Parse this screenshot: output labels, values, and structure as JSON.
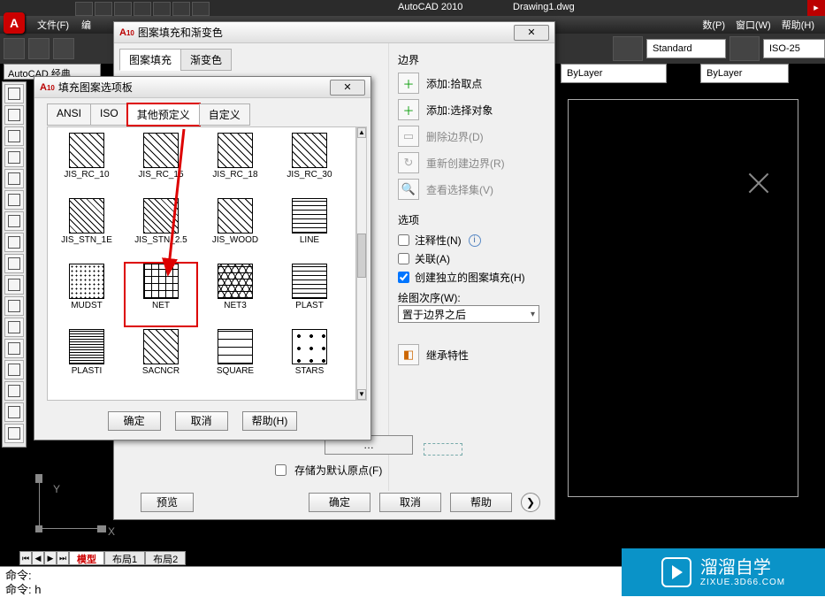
{
  "app": {
    "title": "AutoCAD 2010",
    "file": "Drawing1.dwg"
  },
  "menubar": {
    "left": [
      "文件(F)",
      "编"
    ],
    "right": [
      "数(P)",
      "窗口(W)",
      "帮助(H)"
    ]
  },
  "ribbon": {
    "style1": "Standard",
    "style2": "ISO-25",
    "layer1": "ByLayer",
    "layer2": "ByLayer"
  },
  "classic_label": "AutoCAD 经典",
  "ucs": {
    "x": "X",
    "y": "Y"
  },
  "tabs": {
    "model": "模型",
    "layout1": "布局1",
    "layout2": "布局2"
  },
  "cmd": {
    "line1": "命令:",
    "line2": "命令: h"
  },
  "hatch": {
    "title": "图案填充和渐变色",
    "tab1": "图案填充",
    "tab2": "渐变色",
    "boundary": {
      "heading": "边界",
      "add_pick": "添加:拾取点",
      "add_select": "添加:选择对象",
      "remove": "删除边界(D)",
      "recreate": "重新创建边界(R)",
      "view_sel": "查看选择集(V)"
    },
    "options": {
      "heading": "选项",
      "annot": "注释性(N)",
      "assoc": "关联(A)",
      "indep": "创建独立的图案填充(H)",
      "order_label": "绘图次序(W):",
      "order_value": "置于边界之后"
    },
    "inherit": "继承特性",
    "store_default": "存储为默认原点(F)",
    "preview": "预览",
    "ok": "确定",
    "cancel": "取消",
    "help": "帮助"
  },
  "palette": {
    "title": "填充图案选项板",
    "tabs": {
      "ansi": "ANSI",
      "iso": "ISO",
      "other": "其他预定义",
      "custom": "自定义"
    },
    "buttons": {
      "ok": "确定",
      "cancel": "取消",
      "help": "帮助(H)"
    },
    "patterns": [
      {
        "name": "JIS_RC_10",
        "cls": "p-diag"
      },
      {
        "name": "JIS_RC_15",
        "cls": "p-diag"
      },
      {
        "name": "JIS_RC_18",
        "cls": "p-diag"
      },
      {
        "name": "JIS_RC_30",
        "cls": "p-diag"
      },
      {
        "name": "JIS_STN_1E",
        "cls": "p-diag2"
      },
      {
        "name": "JIS_STN_2.5",
        "cls": "p-diag2"
      },
      {
        "name": "JIS_WOOD",
        "cls": "p-diag"
      },
      {
        "name": "LINE",
        "cls": "p-hline"
      },
      {
        "name": "MUDST",
        "cls": "p-dots"
      },
      {
        "name": "NET",
        "cls": "p-grid",
        "highlight": true
      },
      {
        "name": "NET3",
        "cls": "p-tri"
      },
      {
        "name": "PLAST",
        "cls": "p-hline"
      },
      {
        "name": "PLASTI",
        "cls": "p-thinh"
      },
      {
        "name": "SACNCR",
        "cls": "p-diag"
      },
      {
        "name": "SQUARE",
        "cls": "p-brick"
      },
      {
        "name": "STARS",
        "cls": "p-stars"
      }
    ]
  },
  "watermark": {
    "brand": "溜溜自学",
    "url": "ZIXUE.3D66.COM"
  }
}
